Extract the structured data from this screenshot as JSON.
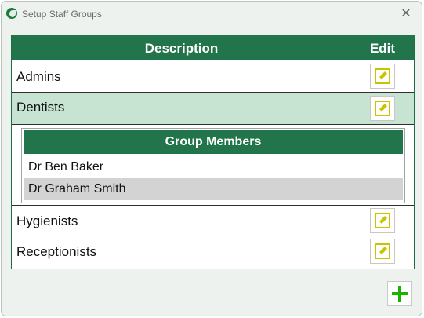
{
  "window": {
    "title": "Setup Staff Groups"
  },
  "table": {
    "headers": {
      "description": "Description",
      "edit": "Edit"
    },
    "rows": [
      {
        "label": "Admins"
      },
      {
        "label": "Dentists"
      },
      {
        "label": "Hygienists"
      },
      {
        "label": "Receptionists"
      }
    ]
  },
  "members": {
    "header": "Group Members",
    "items": [
      {
        "name": "Dr Ben Baker"
      },
      {
        "name": "Dr Graham Smith"
      }
    ]
  },
  "colors": {
    "header_green": "#22744a",
    "selected_row": "#c6e4d1",
    "edit_icon": "#c9c400",
    "add_icon": "#19b400"
  },
  "icons": {
    "edit": "pencil-edit-icon",
    "add": "plus-icon",
    "close": "close-icon"
  }
}
